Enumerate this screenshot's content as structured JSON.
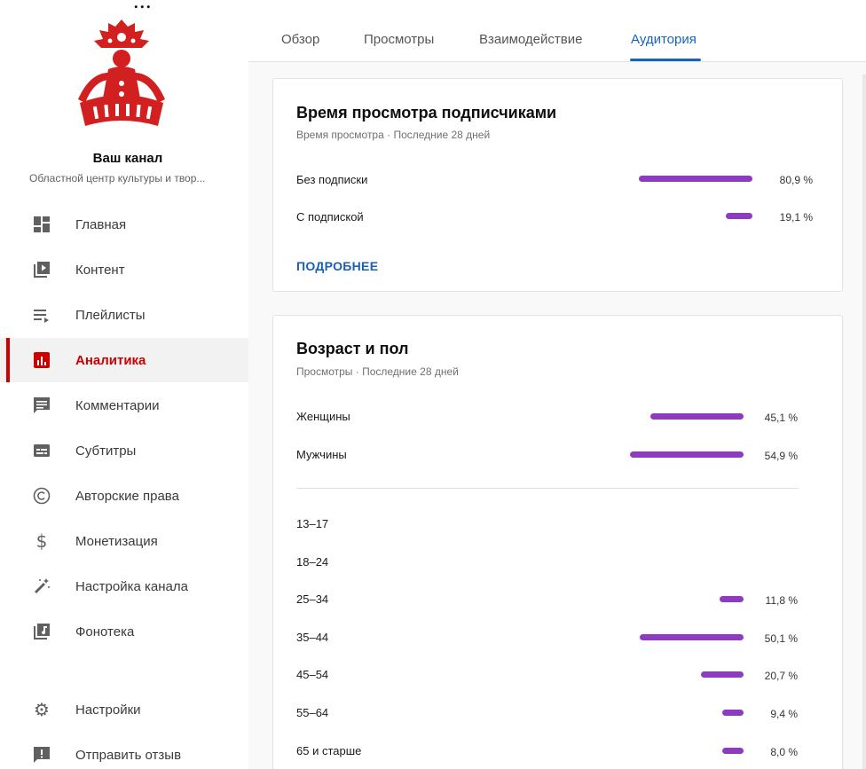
{
  "top_partial_text": "...",
  "sidebar": {
    "channel_title": "Ваш канал",
    "channel_subtitle": "Областной центр культуры и твор...",
    "items": [
      {
        "label": "Главная",
        "icon": "dashboard-icon"
      },
      {
        "label": "Контент",
        "icon": "video-library-icon"
      },
      {
        "label": "Плейлисты",
        "icon": "playlist-icon"
      },
      {
        "label": "Аналитика",
        "icon": "analytics-icon",
        "active": true
      },
      {
        "label": "Комментарии",
        "icon": "comments-icon"
      },
      {
        "label": "Субтитры",
        "icon": "subtitles-icon"
      },
      {
        "label": "Авторские права",
        "icon": "copyright-icon"
      },
      {
        "label": "Монетизация",
        "icon": "dollar-icon"
      },
      {
        "label": "Настройка канала",
        "icon": "magic-wand-icon"
      },
      {
        "label": "Фонотека",
        "icon": "audio-library-icon"
      },
      {
        "label": "Настройки",
        "icon": "gear-icon"
      },
      {
        "label": "Отправить отзыв",
        "icon": "feedback-icon"
      }
    ]
  },
  "tabs": [
    {
      "label": "Обзор"
    },
    {
      "label": "Просмотры"
    },
    {
      "label": "Взаимодействие"
    },
    {
      "label": "Аудитория",
      "active": true
    }
  ],
  "subscriber_watch_time": {
    "title": "Время просмотра подписчиками",
    "subtitle": "Время просмотра · Последние 28 дней",
    "rows": [
      {
        "label": "Без подписки",
        "value": 80.9,
        "display": "80,9 %"
      },
      {
        "label": "С подпиской",
        "value": 19.1,
        "display": "19,1 %"
      }
    ],
    "more_label": "ПОДРОБНЕЕ"
  },
  "age_gender": {
    "title": "Возраст и пол",
    "subtitle": "Просмотры · Последние 28 дней",
    "gender_rows": [
      {
        "label": "Женщины",
        "value": 45.1,
        "display": "45,1 %"
      },
      {
        "label": "Мужчины",
        "value": 54.9,
        "display": "54,9 %"
      }
    ],
    "age_rows": [
      {
        "label": "13–17",
        "value": null,
        "display": ""
      },
      {
        "label": "18–24",
        "value": null,
        "display": ""
      },
      {
        "label": "25–34",
        "value": 11.8,
        "display": "11,8 %"
      },
      {
        "label": "35–44",
        "value": 50.1,
        "display": "50,1 %"
      },
      {
        "label": "45–54",
        "value": 20.7,
        "display": "20,7 %"
      },
      {
        "label": "55–64",
        "value": 9.4,
        "display": "9,4 %"
      },
      {
        "label": "65 и старше",
        "value": 8.0,
        "display": "8,0 %"
      }
    ]
  },
  "colors": {
    "accent_red": "#cc0000",
    "tab_blue": "#1565c0",
    "bar_purple": "#8e3bbf",
    "link_blue": "#1a5fb4"
  }
}
